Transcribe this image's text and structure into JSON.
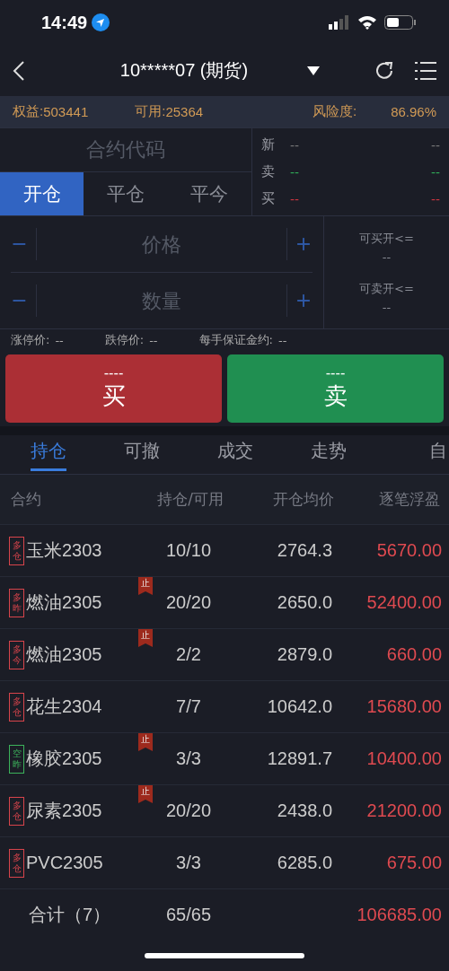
{
  "status_bar": {
    "time": "14:49"
  },
  "nav": {
    "title": "10*****07 (期货)"
  },
  "account": {
    "equity_label": "权益:",
    "equity": "503441",
    "available_label": "可用:",
    "available": "25364",
    "risk_label": "风险度:",
    "risk": "86.96%"
  },
  "contract_placeholder": "合约代码",
  "action_tabs": [
    {
      "label": "开仓",
      "selected": true
    },
    {
      "label": "平仓",
      "selected": false
    },
    {
      "label": "平今",
      "selected": false
    }
  ],
  "quotes": [
    {
      "label": "新",
      "left": "--",
      "right": "--",
      "kind": "neutral"
    },
    {
      "label": "卖",
      "left": "--",
      "right": "--",
      "kind": "green"
    },
    {
      "label": "买",
      "left": "--",
      "right": "--",
      "kind": "red"
    }
  ],
  "price_field": {
    "placeholder": "价格"
  },
  "quantity_field": {
    "placeholder": "数量"
  },
  "limits": [
    {
      "label": "可买开<=",
      "value": "--"
    },
    {
      "label": "可卖开<=",
      "value": "--"
    }
  ],
  "info": [
    {
      "label": "涨停价:",
      "value": "--"
    },
    {
      "label": "跌停价:",
      "value": "--"
    },
    {
      "label": "每手保证金约:",
      "value": "--"
    }
  ],
  "trade_buttons": [
    {
      "price": "----",
      "label": "买",
      "kind": "buy"
    },
    {
      "price": "----",
      "label": "卖",
      "kind": "sell"
    }
  ],
  "tabs": [
    {
      "label": "持仓",
      "selected": true
    },
    {
      "label": "可撤",
      "selected": false
    },
    {
      "label": "成交",
      "selected": false
    },
    {
      "label": "走势",
      "selected": false
    },
    {
      "label": "自",
      "selected": false
    }
  ],
  "table": {
    "columns": [
      "合约",
      "持仓/可用",
      "开仓均价",
      "逐笔浮盈"
    ],
    "rows": [
      {
        "tag": [
          "多",
          "仓"
        ],
        "color": "#d8444b",
        "stop": false,
        "name": "玉米2303",
        "position": "10/10",
        "avg_price": "2764.3",
        "pnl": "5670.00"
      },
      {
        "tag": [
          "多",
          "昨"
        ],
        "color": "#d8444b",
        "stop": true,
        "stop_label": "止",
        "name": "燃油2305",
        "position": "20/20",
        "avg_price": "2650.0",
        "pnl": "52400.00"
      },
      {
        "tag": [
          "多",
          "今"
        ],
        "color": "#d8444b",
        "stop": true,
        "stop_label": "止",
        "name": "燃油2305",
        "position": "2/2",
        "avg_price": "2879.0",
        "pnl": "660.00"
      },
      {
        "tag": [
          "多",
          "仓"
        ],
        "color": "#d8444b",
        "stop": false,
        "name": "花生2304",
        "position": "7/7",
        "avg_price": "10642.0",
        "pnl": "15680.00"
      },
      {
        "tag": [
          "空",
          "昨"
        ],
        "color": "#3cb25b",
        "stop": true,
        "stop_label": "止",
        "name": "橡胶2305",
        "position": "3/3",
        "avg_price": "12891.7",
        "pnl": "10400.00"
      },
      {
        "tag": [
          "多",
          "仓"
        ],
        "color": "#d8444b",
        "stop": true,
        "stop_label": "止",
        "name": "尿素2305",
        "position": "20/20",
        "avg_price": "2438.0",
        "pnl": "21200.00"
      },
      {
        "tag": [
          "多",
          "仓"
        ],
        "color": "#d8444b",
        "stop": false,
        "name": "PVC2305",
        "position": "3/3",
        "avg_price": "6285.0",
        "pnl": "675.00"
      }
    ],
    "total": {
      "label": "合计（7）",
      "position": "65/65",
      "pnl": "106685.00"
    }
  }
}
